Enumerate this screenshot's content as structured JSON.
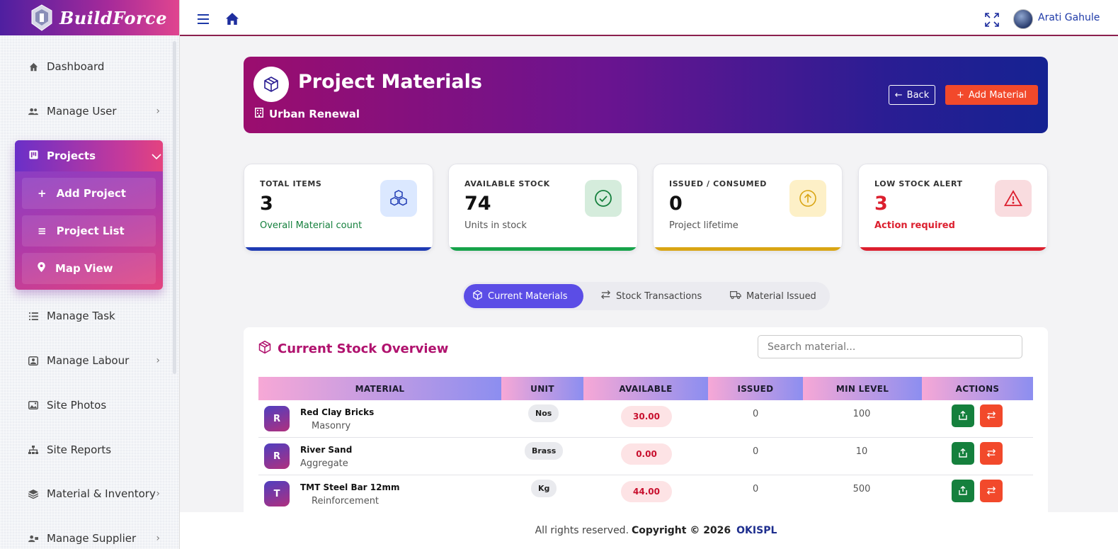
{
  "brand": {
    "name": "BuildForce"
  },
  "sidebar": {
    "items": [
      {
        "label": "Dashboard",
        "icon": "home-icon"
      },
      {
        "label": "Manage User",
        "icon": "users-icon"
      },
      {
        "label": "Projects",
        "icon": "project-icon"
      },
      {
        "label": "Manage Task",
        "icon": "list-icon"
      },
      {
        "label": "Manage Labour",
        "icon": "badge-icon"
      },
      {
        "label": "Site Photos",
        "icon": "image-icon"
      },
      {
        "label": "Site Reports",
        "icon": "sitemap-icon"
      },
      {
        "label": "Material & Inventory",
        "icon": "layers-icon"
      },
      {
        "label": "Manage Supplier",
        "icon": "supplier-icon"
      }
    ],
    "projects_sub": [
      {
        "label": "Add Project",
        "icon": "plus-icon"
      },
      {
        "label": "Project List",
        "icon": "menu-icon"
      },
      {
        "label": "Map View",
        "icon": "map-pin-icon"
      }
    ]
  },
  "topbar": {
    "user_name": "Arati Gahule"
  },
  "banner": {
    "title": "Project Materials",
    "project": "Urban Renewal",
    "back_label": "Back",
    "add_label": "Add Material"
  },
  "stats": [
    {
      "label": "TOTAL ITEMS",
      "value": "3",
      "sub": "Overall Material count",
      "color": "#1f3bb3"
    },
    {
      "label": "AVAILABLE STOCK",
      "value": "74",
      "sub": "Units in stock",
      "color": "#16a34a"
    },
    {
      "label": "ISSUED / CONSUMED",
      "value": "0",
      "sub": "Project lifetime",
      "color": "#d9a514"
    },
    {
      "label": "LOW STOCK ALERT",
      "value": "3",
      "sub": "Action required",
      "color": "#dc1f2e"
    }
  ],
  "tabs": [
    {
      "label": "Current Materials",
      "icon": "box-icon"
    },
    {
      "label": "Stock Transactions",
      "icon": "swap-icon"
    },
    {
      "label": "Material Issued",
      "icon": "truck-icon"
    }
  ],
  "panel": {
    "title": "Current Stock Overview",
    "search_placeholder": "Search material...",
    "columns": [
      "MATERIAL",
      "UNIT",
      "AVAILABLE",
      "ISSUED",
      "MIN LEVEL",
      "ACTIONS"
    ],
    "rows": [
      {
        "initial": "R",
        "name": "Red Clay Bricks",
        "category": "Masonry",
        "unit": "Nos",
        "available": "30.00",
        "issued": "0",
        "min": "100"
      },
      {
        "initial": "R",
        "name": "River Sand",
        "category": "Aggregate",
        "unit": "Brass",
        "available": "0.00",
        "issued": "0",
        "min": "10"
      },
      {
        "initial": "T",
        "name": "TMT Steel Bar 12mm",
        "category": "Reinforcement",
        "unit": "Kg",
        "available": "44.00",
        "issued": "0",
        "min": "500"
      }
    ]
  },
  "footer": {
    "text": "All rights reserved.",
    "copyright": "Copyright © 2026",
    "org": "OKISPL"
  }
}
